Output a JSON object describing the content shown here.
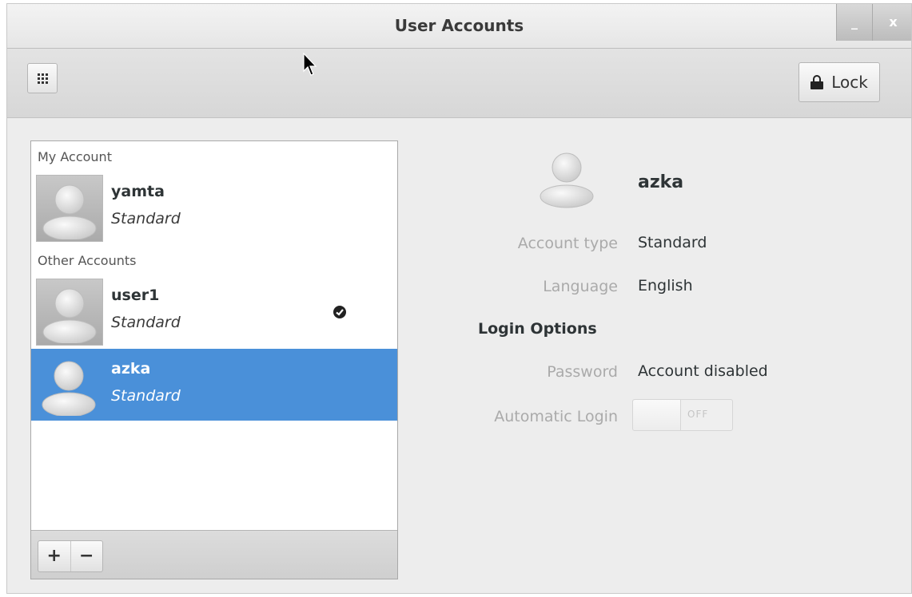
{
  "window": {
    "title": "User Accounts",
    "minimize_glyph": "_",
    "close_glyph": "x"
  },
  "toolbar": {
    "grid_icon": "app-grid-icon",
    "lock_label": "Lock",
    "lock_icon": "lock-icon"
  },
  "sidebar": {
    "my_account_label": "My Account",
    "other_accounts_label": "Other Accounts",
    "users": [
      {
        "name": "yamta",
        "type": "Standard",
        "icon": "avatar-icon"
      },
      {
        "name": "user1",
        "type": "Standard",
        "icon": "avatar-icon",
        "logged_in_icon": "check-icon"
      },
      {
        "name": "azka",
        "type": "Standard",
        "icon": "avatar-icon",
        "selected": true
      }
    ],
    "add_label": "+",
    "remove_label": "−"
  },
  "details": {
    "name": "azka",
    "account_type_label": "Account type",
    "account_type_value": "Standard",
    "language_label": "Language",
    "language_value": "English",
    "login_options_label": "Login Options",
    "password_label": "Password",
    "password_value": "Account disabled",
    "auto_login_label": "Automatic Login",
    "auto_login_state": "OFF"
  },
  "colors": {
    "selection": "#4a90d9",
    "window_bg": "#ededed",
    "dim_label": "#aaaaaa"
  }
}
